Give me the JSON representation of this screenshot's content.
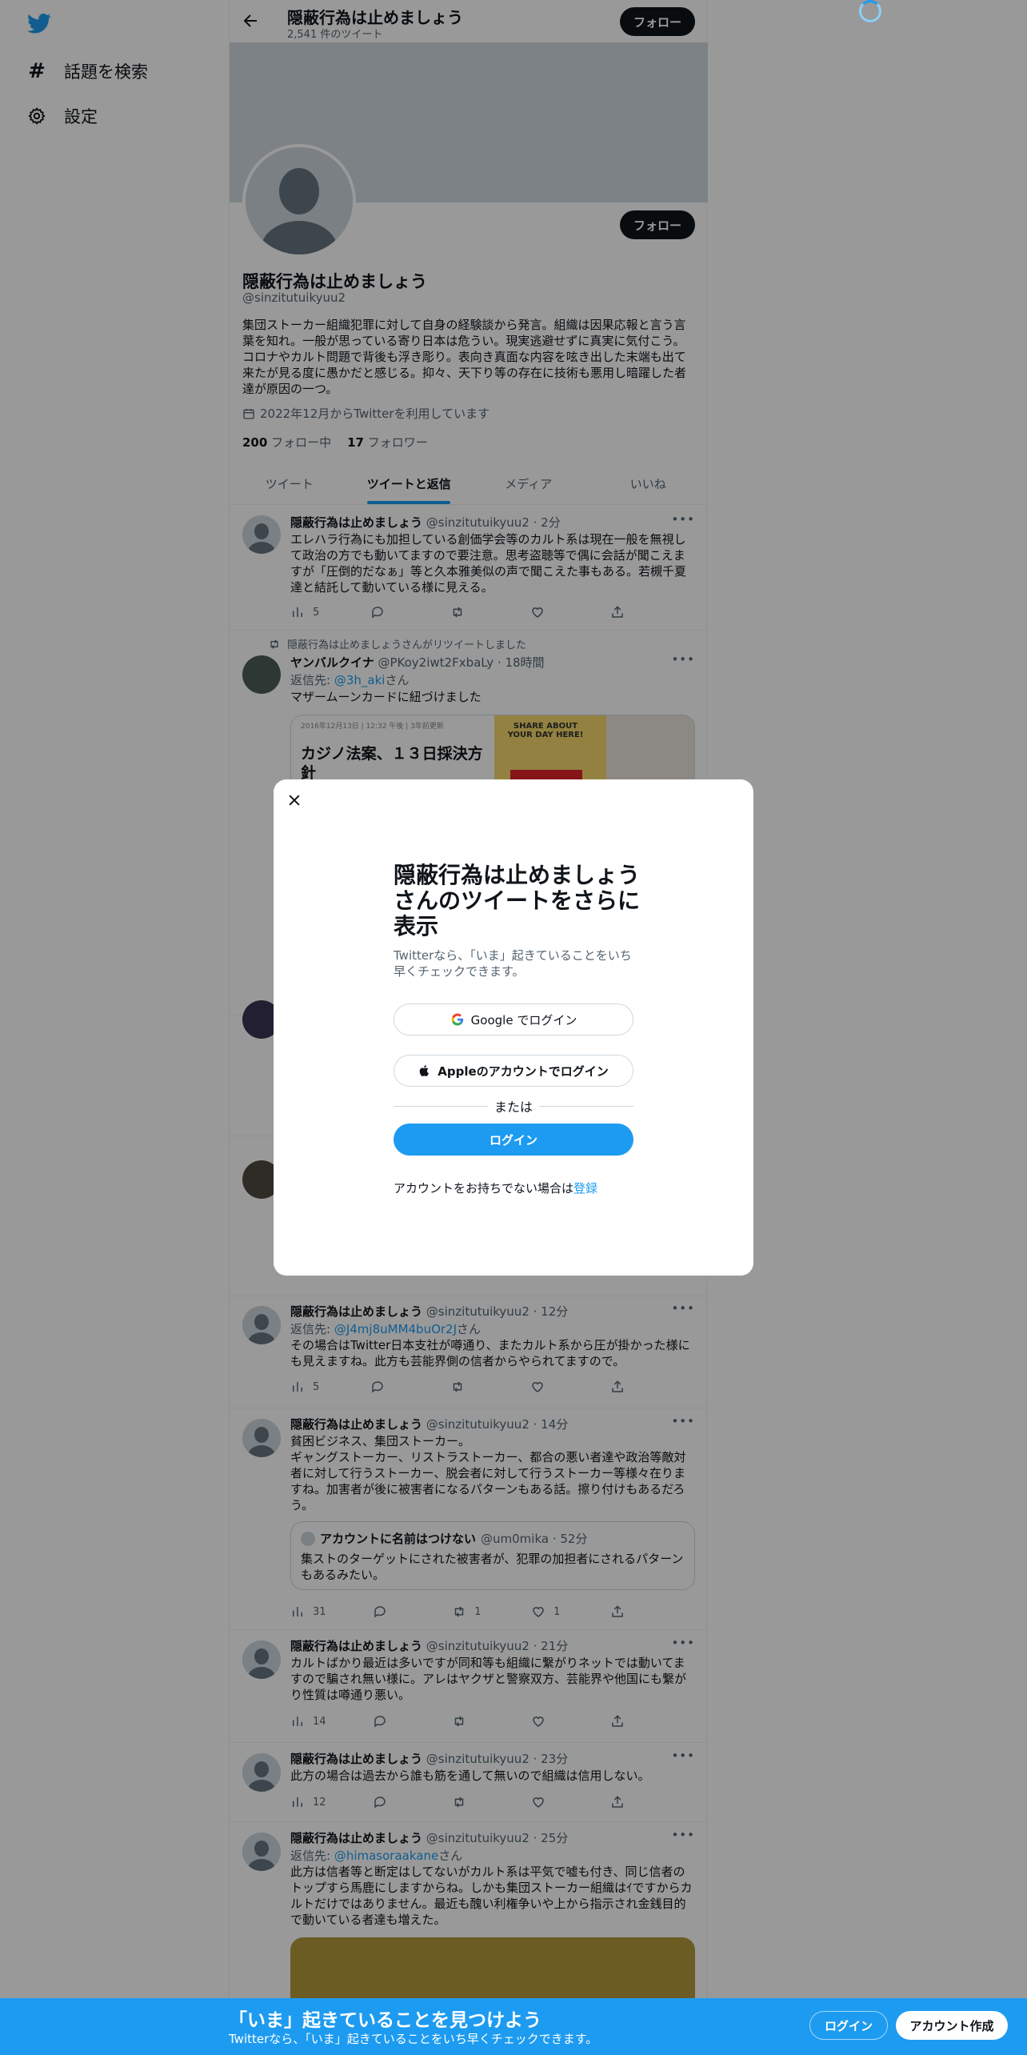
{
  "nav": {
    "explore": "話題を検索",
    "settings": "設定"
  },
  "header": {
    "name": "隠蔽行為は止めましょう",
    "tweet_count": "2,541 件のツイート",
    "follow": "フォロー"
  },
  "profile": {
    "follow": "フォロー",
    "name": "隠蔽行為は止めましょう",
    "handle": "@sinzitutuikyuu2",
    "bio": "集団ストーカー組織犯罪に対して自身の経験談から発言。組織は因果応報と言う言葉を知れ。一般が思っている寄り日本は危うい。現実逃避せずに真実に気付こう。コロナやカルト問題で背後も浮き彫り。表向き真面な内容を呟き出した末端も出て来たが見る度に愚かだと感じる。抑々、天下り等の存在に技術も悪用し暗躍した者達が原因の一つ。",
    "joined": "2022年12月からTwitterを利用しています",
    "following_count": "200",
    "following_label": "フォロー中",
    "followers_count": "17",
    "followers_label": "フォロワー"
  },
  "tabs": [
    "ツイート",
    "ツイートと返信",
    "メディア",
    "いいね"
  ],
  "tweets": [
    {
      "name": "隠蔽行為は止めましょう",
      "meta": "@sinzitutuikyuu2 · 2分",
      "text": "エレハラ行為にも加担している創価学会等のカルト系は現在一般を無視して政治の方でも動いてますので要注意。思考盗聴等で偶に会話が聞こえますが「圧倒的だなぁ」等と久本雅美似の声で聞こえた事もある。若槻千夏達と結託して動いている様に見える。",
      "views": "5",
      "replies": "",
      "retweets": "",
      "likes": ""
    },
    {
      "retweeted_by": "隠蔽行為は止めましょうさんがリツイートしました",
      "name": "ヤンバルクイナ",
      "meta": "@PKoy2iwt2FxbaLy · 18時間",
      "reply_label": "返信先: ",
      "reply_to": "@3h_aki",
      "reply_suffix": "さん",
      "text": "マザームーンカードに紐づけました",
      "card_title": "カジノ法案、１３日採決方針",
      "card_overline": "2016年12月13日 | 12:32 午後 | 3年前更新",
      "card_image_text": "SHARE ABOUT YOUR DAY HERE!"
    },
    {
      "name": "隠蔽行為は止めましょう",
      "meta": "@sinzitutuikyuu2 · 12分",
      "reply_label": "返信先: ",
      "reply_to": "@J4mj8uMM4buOr2J",
      "reply_suffix": "さん",
      "text": "その場合はTwitter日本支社が噂通り、またカルト系から圧が掛かった様にも見えますね。此方も芸能界側の信者からやられてますので。",
      "views": "5",
      "replies": "",
      "retweets": "",
      "likes": ""
    },
    {
      "name": "隠蔽行為は止めましょう",
      "meta": "@sinzitutuikyuu2 · 14分",
      "text": "貧困ビジネス、集団ストーカー。\nギャングストーカー、リストラストーカー、都合の悪い者達や政治等敵対者に対して行うストーカー、脱会者に対して行うストーカー等様々在りますね。加害者が後に被害者になるパターンもある話。擦り付けもあるだろう。",
      "quote_name": "アカウントに名前はつけない",
      "quote_meta": "@um0mika · 52分",
      "quote_text": "集ストのターゲットにされた被害者が、犯罪の加担者にされるパターンもあるみたい。",
      "views": "31",
      "replies": "",
      "retweets": "1",
      "likes": "1"
    },
    {
      "name": "隠蔽行為は止めましょう",
      "meta": "@sinzitutuikyuu2 · 21分",
      "text": "カルトばかり最近は多いですが同和等も組織に繋がりネットでは動いてますので騙され無い様に。アレはヤクザと警察双方、芸能界や他国にも繋がり性質は噂通り悪い。",
      "views": "14",
      "replies": "",
      "retweets": "",
      "likes": ""
    },
    {
      "name": "隠蔽行為は止めましょう",
      "meta": "@sinzitutuikyuu2 · 23分",
      "text": "此方の場合は過去から誰も筋を通して無いので組織は信用しない。",
      "views": "12",
      "replies": "",
      "retweets": "",
      "likes": ""
    },
    {
      "name": "隠蔽行為は止めましょう",
      "meta": "@sinzitutuikyuu2 · 25分",
      "reply_label": "返信先: ",
      "reply_to": "@himasoraakane",
      "reply_suffix": "さん",
      "text": "此方は信者等と断定はしてないがカルト系は平気で嘘も付き、同じ信者のトップすら馬鹿にしますからね。しかも集団ストーカー組織はｲですからカルトだけではありません。最近も醜い利権争いや上から指示され金銭目的で動いている者達も増えた。"
    }
  ],
  "modal": {
    "title": "隠蔽行為は止めましょうさんのツイートをさらに表示",
    "subtitle": "Twitterなら、「いま」起きていることをいち早くチェックできます。",
    "google": "Google でログイン",
    "apple": "Appleのアカウントでログイン",
    "or": "または",
    "login": "ログイン",
    "no_account": "アカウントをお持ちでない場合は",
    "signup": "登録"
  },
  "bottom": {
    "title": "「いま」起きていることを見つけよう",
    "subtitle": "Twitterなら、「いま」起きていることをいち早くチェックできます。",
    "login": "ログイン",
    "signup": "アカウント作成"
  },
  "colors": {
    "accent": "#1d9bf0",
    "text": "#0f1419",
    "muted": "#536471",
    "border": "#cfd9de"
  }
}
